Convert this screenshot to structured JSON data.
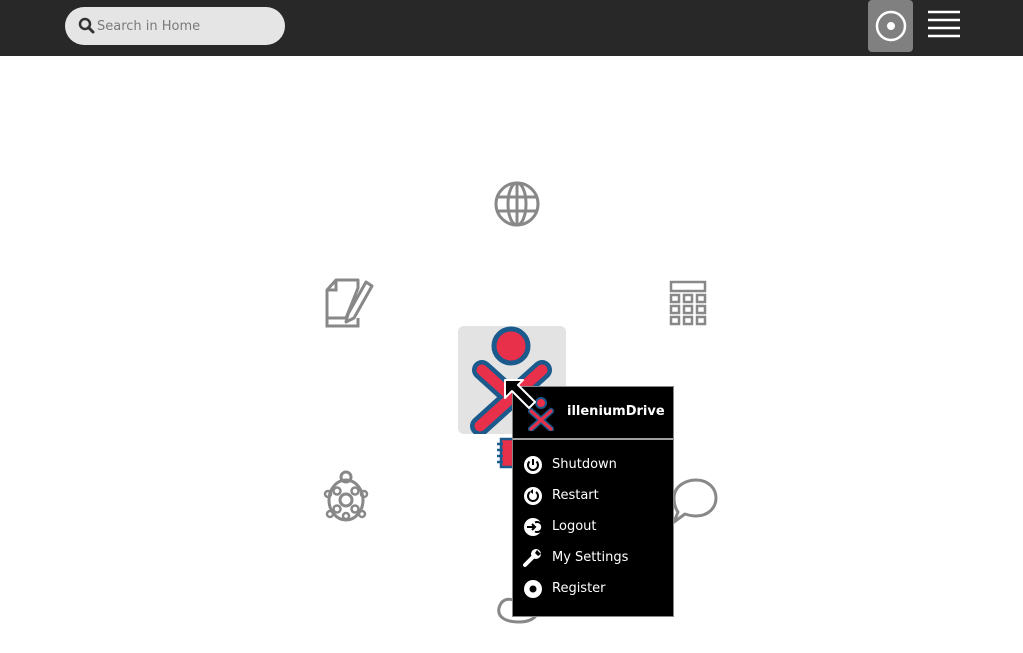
{
  "search": {
    "placeholder": "Search in Home"
  },
  "topbar": {
    "view_button_icon": "home-view-icon",
    "list_button_icon": "list-view-icon"
  },
  "home_icons": [
    {
      "name": "browse-activity-icon"
    },
    {
      "name": "write-activity-icon"
    },
    {
      "name": "calculate-activity-icon"
    },
    {
      "name": "turtleart-activity-icon"
    },
    {
      "name": "chat-activity-icon"
    },
    {
      "name": "pippy-activity-icon"
    },
    {
      "name": "journal-icon"
    }
  ],
  "palette": {
    "title": "illeniumDrive",
    "items": [
      {
        "label": "Shutdown",
        "icon": "shutdown-icon"
      },
      {
        "label": "Restart",
        "icon": "restart-icon"
      },
      {
        "label": "Logout",
        "icon": "logout-icon"
      },
      {
        "label": "My Settings",
        "icon": "settings-icon"
      },
      {
        "label": "Register",
        "icon": "register-icon"
      }
    ]
  },
  "colors": {
    "topbar": "#282828",
    "xo_stroke": "#1a5a8c",
    "xo_fill": "#e8304a",
    "icon_gray": "#888888"
  }
}
